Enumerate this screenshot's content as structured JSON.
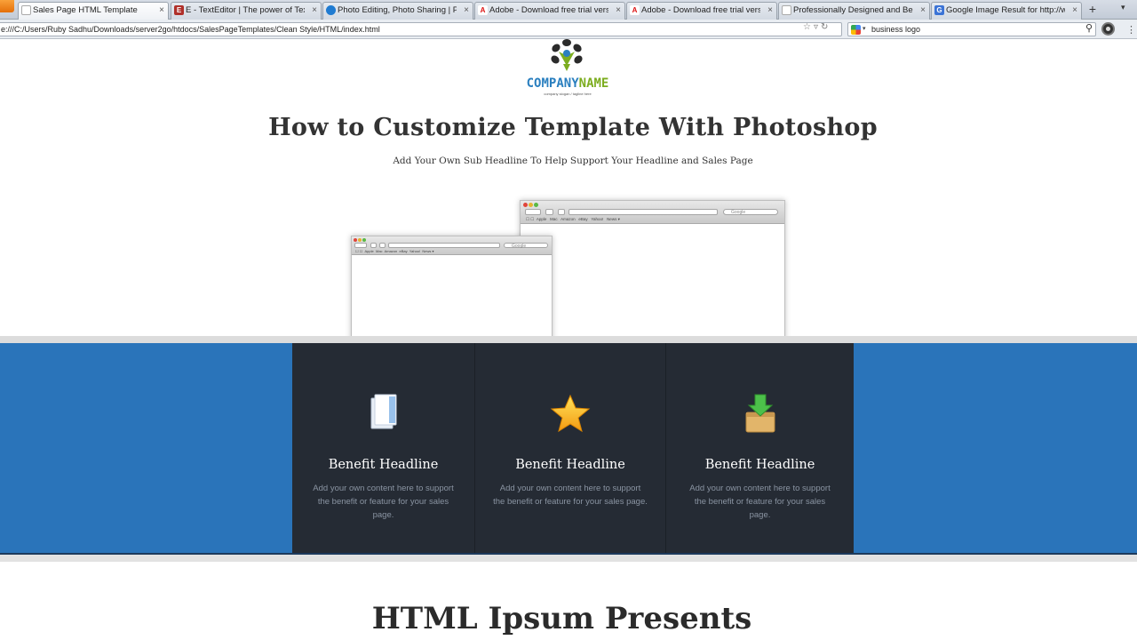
{
  "browser": {
    "tabs": [
      {
        "title": "Sales Page HTML Template",
        "icon": "page-icon",
        "active": true
      },
      {
        "title": "E - TextEditor | The power of TextM...",
        "icon": "texteditor-icon"
      },
      {
        "title": "Photo Editing, Photo Sharing | Pho...",
        "icon": "photobucket-icon"
      },
      {
        "title": "Adobe - Download free trial versio...",
        "icon": "adobe-icon"
      },
      {
        "title": "Adobe - Download free trial versio...",
        "icon": "adobe-icon"
      },
      {
        "title": "Professionally Designed and Beauti...",
        "icon": "page-icon"
      },
      {
        "title": "Google Image Result for http://ww...",
        "icon": "google-icon"
      }
    ],
    "close_glyph": "×",
    "new_tab_glyph": "+",
    "url": "e:///C:/Users/Ruby Sadhu/Downloads/server2go/htdocs/SalesPageTemplates/Clean Style/HTML/index.html",
    "search_query": "business logo"
  },
  "page": {
    "logo": {
      "name_part1": "COMPANY",
      "name_part2": "NAME",
      "slogan": "company slogan / tagline here"
    },
    "headline": "How to Customize Template With Photoshop",
    "subheadline": "Add Your Own Sub Headline To Help Support Your Headline and Sales Page",
    "mockup_bookmarks": [
      "Apple",
      "Mac",
      "Amazon",
      "eBay",
      "Yahoo!",
      "News ▾"
    ],
    "mockup_search": "Google",
    "benefits": [
      {
        "icon": "document-icon",
        "title": "Benefit Headline",
        "text": "Add your own content here to support the benefit or feature for your sales page."
      },
      {
        "icon": "star-icon",
        "title": "Benefit Headline",
        "text": "Add your own content here to support the benefit or feature for your sales page."
      },
      {
        "icon": "download-box-icon",
        "title": "Benefit Headline",
        "text": "Add your own content here to support the benefit or feature for your sales page."
      }
    ],
    "section_title": "HTML Ipsum Presents"
  },
  "colors": {
    "band_blue": "#2a74ba",
    "benefit_panel": "#252b34",
    "logo_blue": "#2a7fbf",
    "logo_green": "#7cad1f"
  }
}
